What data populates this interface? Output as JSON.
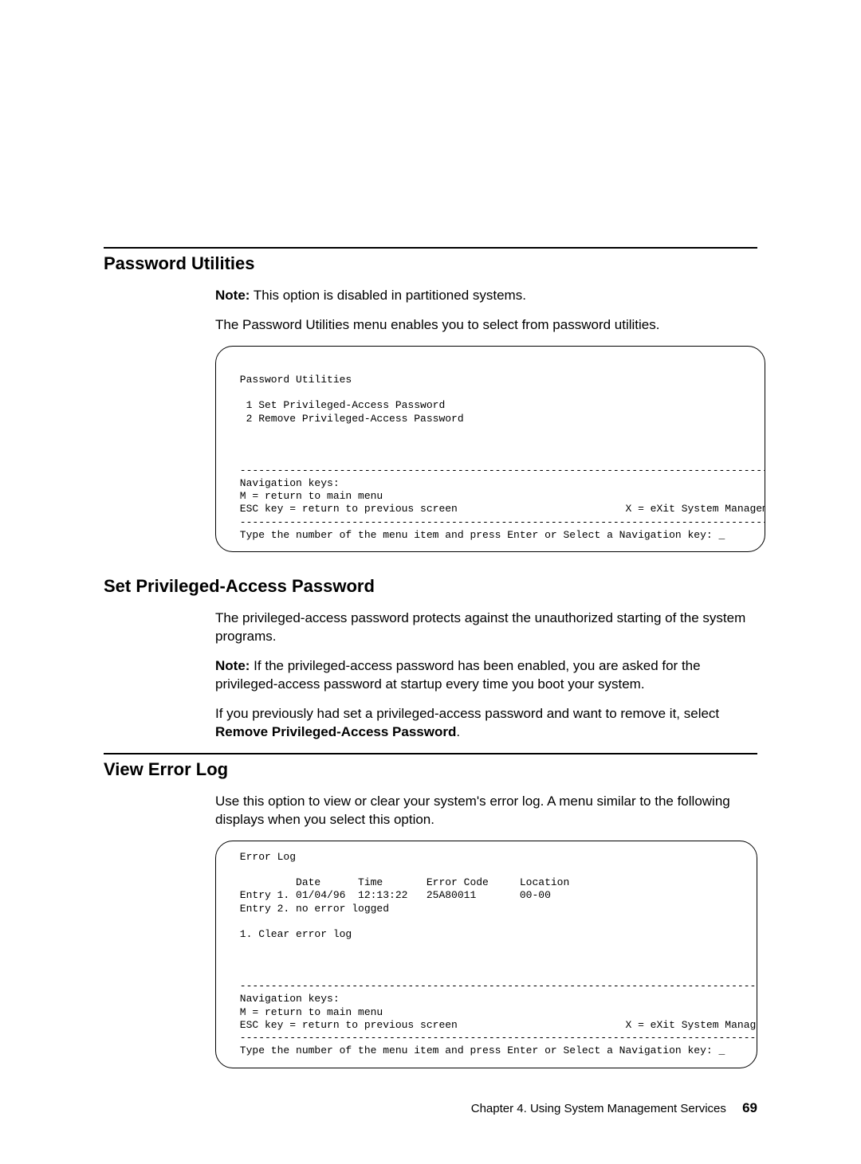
{
  "sections": {
    "pw_utils": {
      "title": "Password Utilities",
      "note_label": "Note:",
      "note_text": " This option is disabled in partitioned systems.",
      "intro": "The Password Utilities menu enables you to select from password utilities."
    },
    "set_pw": {
      "title": "Set Privileged-Access Password",
      "p1": "The privileged-access password protects against the unauthorized starting of the system programs.",
      "note_label": "Note:",
      "note_text": " If the privileged-access password has been enabled, you are asked for the privileged-access password at startup every time you boot your system.",
      "p2a": "If you previously had set a privileged-access password and want to remove it, select ",
      "p2b": "Remove Privileged-Access Password",
      "p2c": "."
    },
    "err_log": {
      "title": "View Error Log",
      "p1": "Use this option to view or clear your system's error log. A menu similar to the following displays when you select this option."
    }
  },
  "terminal1": " Password Utilities\n\n  1 Set Privileged-Access Password\n  2 Remove Privileged-Access Password\n\n\n\n ------------------------------------------------------------------------------------------------\n Navigation keys:\n M = return to main menu\n ESC key = return to previous screen                           X = eXit System Management Services\n ------------------------------------------------------------------------------------------------\n Type the number of the menu item and press Enter or Select a Navigation key: _",
  "terminal2": " Error Log\n\n          Date      Time       Error Code     Location\n Entry 1. 01/04/96  12:13:22   25A80011       00-00\n Entry 2. no error logged\n\n 1. Clear error log\n\n\n\n ------------------------------------------------------------------------------------------------\n Navigation keys:\n M = return to main menu\n ESC key = return to previous screen                           X = eXit System Management Services\n ------------------------------------------------------------------------------------------------\n Type the number of the menu item and press Enter or Select a Navigation key: _",
  "footer": {
    "chapter": "Chapter 4. Using System Management Services",
    "page": "69"
  }
}
